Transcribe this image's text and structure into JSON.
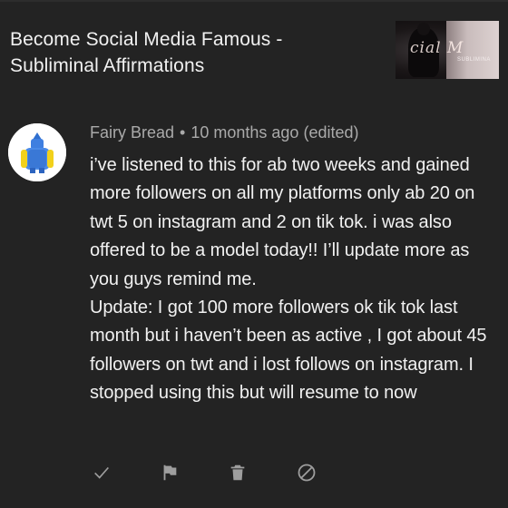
{
  "video": {
    "title": "Become Social Media Famous - Subliminal Affirmations",
    "thumbnail": {
      "script_text": "cial M",
      "small_text": "SUBLIMINA"
    }
  },
  "comment": {
    "author": "Fairy Bread",
    "separator": "•",
    "time": "10 months ago (edited)",
    "paragraphs": [
      "i’ve listened to this for ab two weeks and gained more followers on all my platforms only ab 20 on twt 5 on instagram and 2 on tik tok. i was also offered to be a model today!! I’ll update more as you guys remind me.",
      "Update: I got 100 more followers ok tik tok last month but i haven’t been as active , I got about 45 followers on twt and i lost follows on instagram. I stopped using this but will resume to now"
    ]
  },
  "actions": [
    {
      "name": "check-icon"
    },
    {
      "name": "flag-icon"
    },
    {
      "name": "trash-icon"
    },
    {
      "name": "block-icon"
    }
  ],
  "colors": {
    "background": "#232323",
    "text_primary": "#f1f1f1",
    "text_secondary": "#aaaaaa",
    "icon": "#9e9e9e"
  }
}
